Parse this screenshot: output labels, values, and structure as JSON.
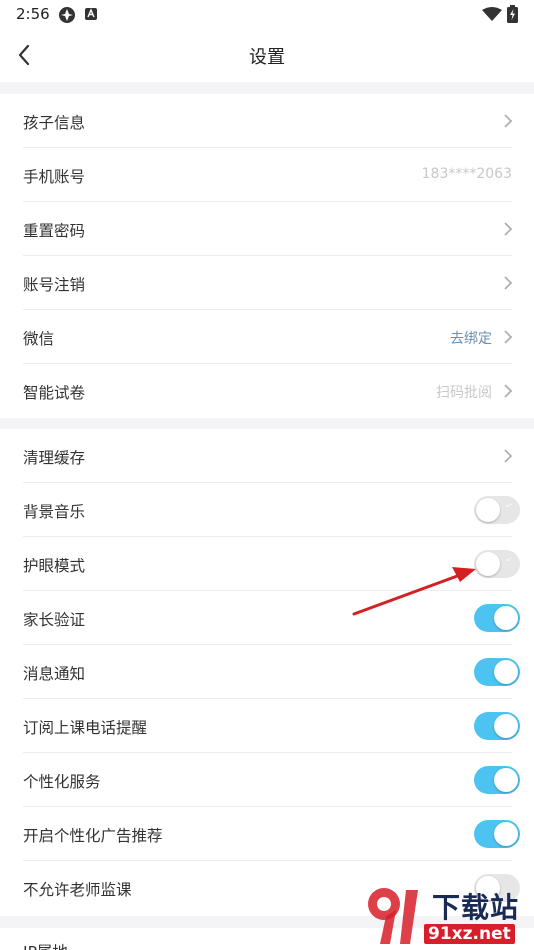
{
  "status_bar": {
    "time": "2:56"
  },
  "header": {
    "title": "设置"
  },
  "section1": [
    {
      "label": "孩子信息",
      "value": "",
      "accessory": "chevron"
    },
    {
      "label": "手机账号",
      "value": "183****2063",
      "accessory": "none"
    },
    {
      "label": "重置密码",
      "value": "",
      "accessory": "chevron"
    },
    {
      "label": "账号注销",
      "value": "",
      "accessory": "chevron"
    },
    {
      "label": "微信",
      "value": "去绑定",
      "accessory": "chevron"
    },
    {
      "label": "智能试卷",
      "value": "扫码批阅",
      "accessory": "chevron"
    }
  ],
  "section2": [
    {
      "label": "清理缓存",
      "accessory": "chevron"
    },
    {
      "label": "背景音乐",
      "toggle": false
    },
    {
      "label": "护眼模式",
      "toggle": false
    },
    {
      "label": "家长验证",
      "toggle": true
    },
    {
      "label": "消息通知",
      "toggle": true
    },
    {
      "label": "订阅上课电话提醒",
      "toggle": true
    },
    {
      "label": "个性化服务",
      "toggle": true
    },
    {
      "label": "开启个性化广告推荐",
      "toggle": true
    },
    {
      "label": "不允许老师监课",
      "toggle": false
    }
  ],
  "section3": [
    {
      "label": "IP属地"
    }
  ],
  "watermark": {
    "brand": "下载站",
    "site": "91xz.net"
  },
  "colors": {
    "toggle_on": "#4cc3f0",
    "toggle_off": "#e6e6e6",
    "annotation_arrow": "#d42020",
    "value_gray": "#c8c8c8",
    "value_blue": "#6b8fb0"
  }
}
